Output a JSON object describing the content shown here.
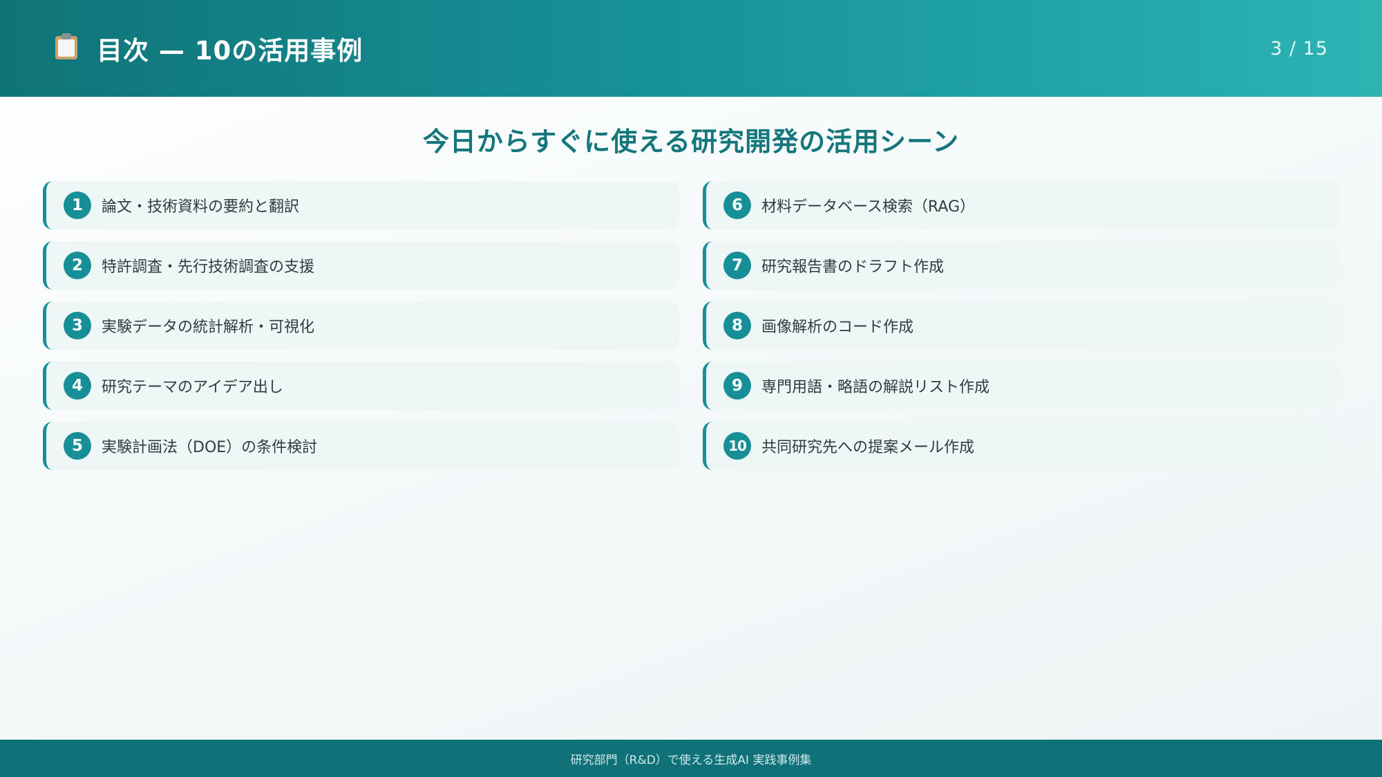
{
  "header": {
    "icon": "clipboard-icon",
    "title": "目次 — 10の活用事例",
    "page_counter": "3 / 15"
  },
  "subtitle": "今日からすぐに使える研究開発の活用シーン",
  "items": [
    {
      "number": "1",
      "label": "論文・技術資料の要約と翻訳"
    },
    {
      "number": "6",
      "label": "材料データベース検索（RAG）"
    },
    {
      "number": "2",
      "label": "特許調査・先行技術調査の支援"
    },
    {
      "number": "7",
      "label": "研究報告書のドラフト作成"
    },
    {
      "number": "3",
      "label": "実験データの統計解析・可視化"
    },
    {
      "number": "8",
      "label": "画像解析のコード作成"
    },
    {
      "number": "4",
      "label": "研究テーマのアイデア出し"
    },
    {
      "number": "9",
      "label": "専門用語・略語の解説リスト作成"
    },
    {
      "number": "5",
      "label": "実験計画法（DOE）の条件検討"
    },
    {
      "number": "10",
      "label": "共同研究先への提案メール作成"
    }
  ],
  "footer": {
    "text": "研究部門（R&D）で使える生成AI 実践事例集"
  },
  "colors": {
    "accent": "#178f96",
    "header_start": "#0f7478",
    "header_end": "#2cb4b3",
    "footer": "#107179",
    "card_bg": "#eff6f6"
  }
}
